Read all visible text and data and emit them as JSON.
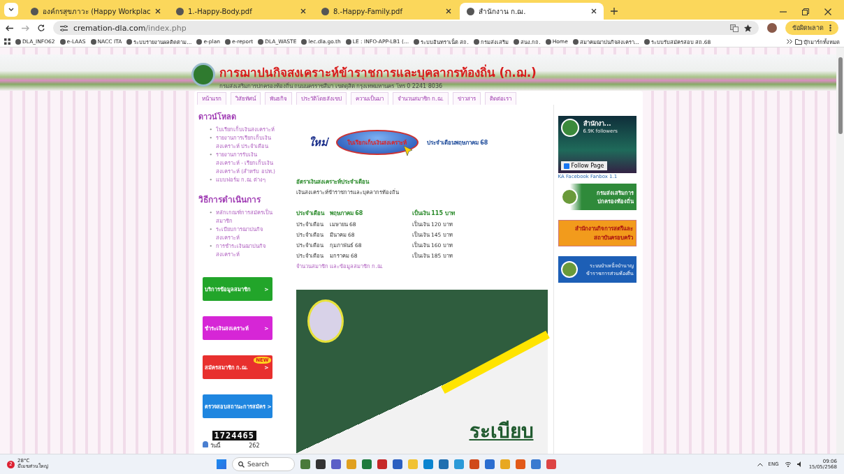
{
  "browser": {
    "tabs": [
      {
        "title": "องค์กรสุขภาวะ (Happy Workplac",
        "selected": false
      },
      {
        "title": "1.-Happy-Body.pdf",
        "selected": false
      },
      {
        "title": "8.-Happy-Family.pdf",
        "selected": false
      },
      {
        "title": "สำนักงาน ก.ฌ.",
        "selected": true
      }
    ],
    "url_host": "cremation-dla.com",
    "url_path": "/index.php",
    "profile_button": "ข้อผิดพลาด",
    "bookmarks": [
      "DLA_INFO62",
      "e-LAAS",
      "NACC ITA",
      "ระบบรายงานผลติดตาม...",
      "e-plan",
      "e-report",
      "DLA_WASTE",
      "lec.dla.go.th",
      "LE : INFO-APP-LB1 (...",
      "ระบบอินทราเน็ต สถ.",
      "กรมส่งเสริม",
      "สนง.กถ.",
      "Home",
      "สมาคมฌาปนกิจสงเครา...",
      "ระบบรับสมัครสอบ สถ.68"
    ],
    "all_bookmarks": "บุ๊กมาร์กทั้งหมด"
  },
  "site": {
    "title": "การฌาปนกิจสงเคราะห์ข้าราชการและบุคลากรท้องถิ่น (ก.ฌ.)",
    "subtitle": "กรมส่งเสริมการปกครองท้องถิ่น ถนนนครราชสีมา เขตดุสิต กรุงเทพมหานคร โทร 0 2241 8036",
    "nav": [
      "หน้าแรก",
      "วิสัยทัศน์",
      "พันธกิจ",
      "ประวัติโดยสังเขป",
      "ความเป็นมา",
      "จำนวนสมาชิก ก.ฌ.",
      "ข่าวสาร",
      "ติดต่อเรา"
    ],
    "sections": [
      {
        "heading": "ดาวน์โหลด",
        "bullet": "•",
        "links": [
          "ใบเรียกเก็บเงินสงเคราะห์",
          "รายงานการเรียกเก็บเงินสงเคราะห์ ประจำเดือน",
          "รายงานการรับเงินสงเคราะห์ - เรียกเก็บเงินสงเคราะห์ (สำหรับ อปท.)",
          "แบบฟอร์ม ก.ฌ. ต่างๆ"
        ]
      },
      {
        "heading": "วิธีการดำเนินการ",
        "bullet": "•",
        "links": [
          "หลักเกณฑ์การสมัครเป็นสมาชิก",
          "ระเบียบการฌาปนกิจสงเคราะห์",
          "การชำระเงินฌาปนกิจสงเคราะห์"
        ]
      }
    ],
    "buttons": [
      {
        "label": "บริการข้อมูลสมาชิก",
        "arrow": ">",
        "color": "#22a52a"
      },
      {
        "label": "ชำระเงินสงเคราะห์",
        "arrow": ">",
        "color": "#d626d6"
      },
      {
        "label": "สมัครสมาชิก ก.ฌ.",
        "arrow": ">",
        "color": "#e8302e",
        "badge": "NEW"
      },
      {
        "label": "ตรวจสอบสถานะการสมัคร",
        "arrow": ">",
        "color": "#1f86e0"
      }
    ],
    "counter": "1724465",
    "today_label": "วันนี้",
    "today_count": "262",
    "promo": {
      "new": "ใหม่",
      "button": "ใบเรียกเก็บเงินสงเคราะห์",
      "month": "ประจำเดือนพฤษภาคม 68"
    },
    "rates": {
      "heading": "อัตราเงินสงเคราะห์ประจำเดือน",
      "subheading": "เงินสงเคราะห์ข้าราชการและบุคลากรท้องถิ่น",
      "rows": [
        {
          "label": "ประจำเดือน",
          "month": "พฤษภาคม 68",
          "amount": "เป็นเงิน 115 บาท",
          "current": true
        },
        {
          "label": "ประจำเดือน",
          "month": "เมษายน 68",
          "amount": "เป็นเงิน 120 บาท",
          "current": false
        },
        {
          "label": "ประจำเดือน",
          "month": "มีนาคม 68",
          "amount": "เป็นเงิน 145 บาท",
          "current": false
        },
        {
          "label": "ประจำเดือน",
          "month": "กุมภาพันธ์ 68",
          "amount": "เป็นเงิน 160 บาท",
          "current": false
        },
        {
          "label": "ประจำเดือน",
          "month": "มกราคม 68",
          "amount": "เป็นเงิน 185 บาท",
          "current": false
        }
      ],
      "link": "จำนวนสมาชิก และข้อมูลสมาชิก ก.ฌ."
    },
    "banner_text": "ระเบียบ",
    "facebook": {
      "name": "สำนักงา...",
      "followers": "6.9K followers",
      "follow": "Follow Page",
      "caption": "KA Facebook Fanbox 1.1"
    },
    "side_banners": [
      {
        "text": "กรมส่งเสริมการปกครองท้องถิ่น",
        "kind": "green"
      },
      {
        "text": "สำนักงานกิจการสตรีและสถาบันครอบครัว",
        "kind": "orange"
      },
      {
        "text": "ระบบบำเหน็จบำนาญข้าราชการส่วนท้องถิ่น",
        "kind": "blue"
      }
    ]
  },
  "taskbar": {
    "badge": "2",
    "temp": "28°C",
    "weather": "มีเมฆส่วนใหญ่",
    "search": "Search",
    "lang": "ENG",
    "time": "09:06",
    "date": "15/05/2568"
  }
}
